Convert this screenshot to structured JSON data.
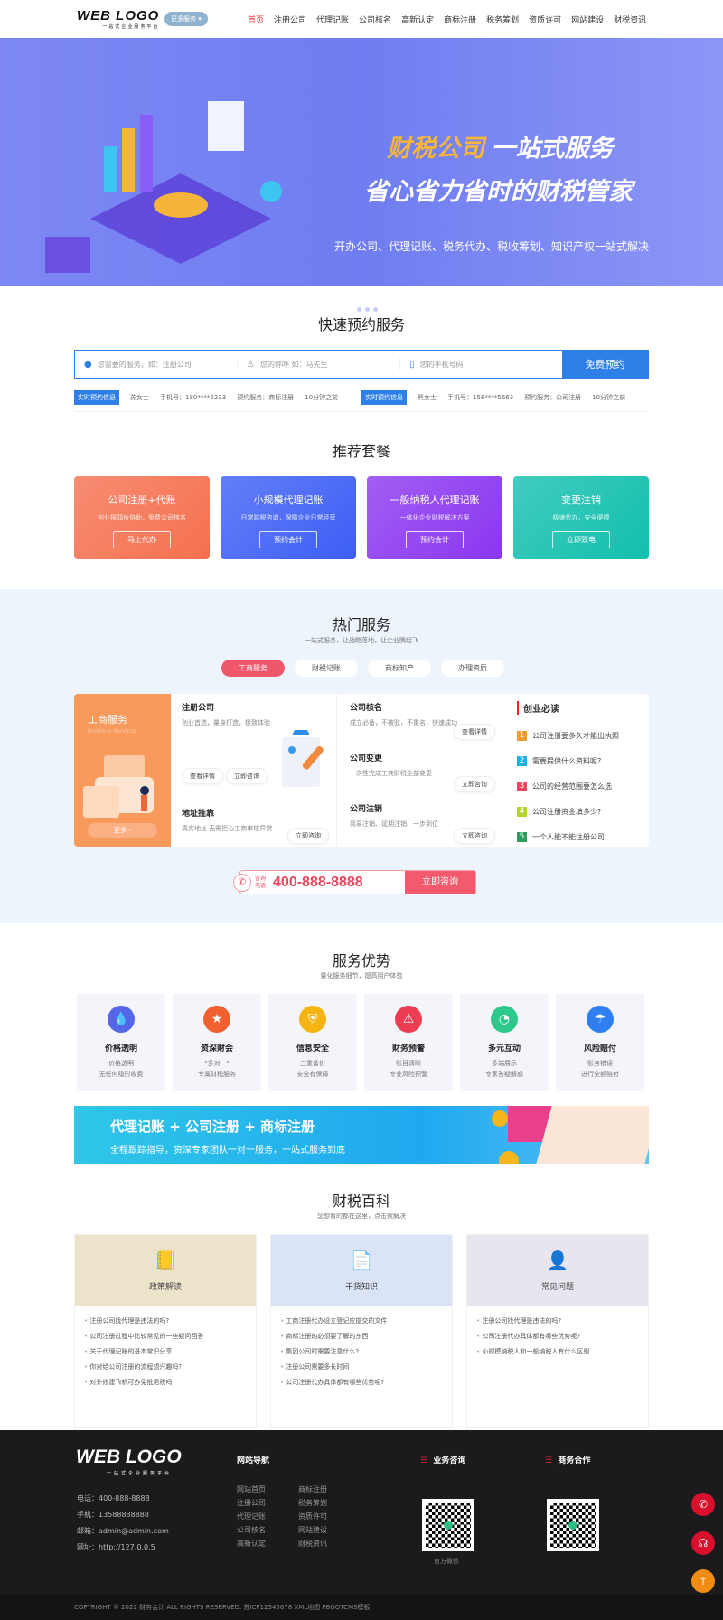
{
  "header": {
    "logo": "WEB LOGO",
    "logo_sub": "一站式企业服务平台",
    "more_button": "更多服务 ▾",
    "nav": [
      "首页",
      "注册公司",
      "代理记账",
      "公司核名",
      "高新认定",
      "商标注册",
      "税务筹划",
      "资质许可",
      "网站建设",
      "财税资讯"
    ],
    "active_nav": "首页"
  },
  "banner": {
    "title_accent": "财税公司",
    "title_rest": "一站式服务",
    "subtitle": "省心省力省时的财税管家",
    "desc": "开办公司、代理记账、税务代办、税收筹划、知识产权一站式解决",
    "slides": 4,
    "active_slide": 1
  },
  "booking": {
    "title": "快速预约服务",
    "service_placeholder": "您需要的服务，如：注册公司",
    "name_placeholder": "您的称呼 如：马先生",
    "phone_placeholder": "您的手机号码",
    "submit": "免费预约",
    "records": [
      {
        "tag": "实时预约信息",
        "name": "苏女士",
        "phone": "手机号：180****2233",
        "service": "预约服务：商标注册",
        "time": "10分钟之前"
      },
      {
        "tag": "实时预约信息",
        "name": "熊女士",
        "phone": "手机号：158****5663",
        "service": "预约服务：公司注册",
        "time": "10分钟之前"
      }
    ]
  },
  "packages": {
    "title": "推荐套餐",
    "items": [
      {
        "title": "公司注册+代账",
        "desc": "创业报四价协助，免费公司核名",
        "button": "马上代办",
        "color": "#f5704f"
      },
      {
        "title": "小规模代理记账",
        "desc": "日常财税咨询，保障企业日常经营",
        "button": "预约会计",
        "color": "#3d5ef5"
      },
      {
        "title": "一般纳税人代理记账",
        "desc": "一体化企业财税解决方案",
        "button": "预约会计",
        "color": "#8a36f0"
      },
      {
        "title": "变更注销",
        "desc": "极速代办，安全便捷",
        "button": "立即致电",
        "color": "#12bfae"
      }
    ]
  },
  "hot": {
    "title": "热门服务",
    "subtitle": "一站式服务，让战略落地，让企业腾起飞",
    "tabs": [
      "工商服务",
      "财税记账",
      "商标知产",
      "办理资质"
    ],
    "active_tab": "工商服务",
    "side": {
      "title": "工商服务",
      "subtitle": "Business Services",
      "more": "更多 ›"
    },
    "services": [
      {
        "title": "注册公司",
        "desc": "创业首选，量身打造，极致体验",
        "buttons": [
          "查看详情",
          "立即咨询"
        ]
      },
      {
        "title": "地址挂靠",
        "desc": "真实地址 无需担心工商审核异常",
        "buttons": [
          "立即咨询"
        ]
      },
      {
        "title": "公司核名",
        "desc": "成立必备，不被驳，不重名，快速成功",
        "buttons": [
          "查看详情"
        ]
      },
      {
        "title": "公司变更",
        "desc": "一次性完成工商财税全部变更",
        "buttons": [
          "立即咨询"
        ]
      },
      {
        "title": "公司注销",
        "desc": "简易注销、延期注销、一步到位",
        "buttons": [
          "立即咨询"
        ]
      }
    ],
    "reading": {
      "title": "创业必读",
      "items": [
        {
          "n": "1",
          "text": "公司注册要多久才能出执照",
          "color": "#f39a2d"
        },
        {
          "n": "2",
          "text": "需要提供什么资料呢?",
          "color": "#1eaee8"
        },
        {
          "n": "3",
          "text": "公司的经营范围要怎么选",
          "color": "#e8475e"
        },
        {
          "n": "4",
          "text": "公司注册资金填多少?",
          "color": "#b6d433"
        },
        {
          "n": "5",
          "text": "一个人能不能注册公司",
          "color": "#2e9c5f"
        }
      ]
    },
    "hotline": {
      "label1": "咨询",
      "label2": "电话",
      "number": "400-888-8888",
      "button": "立即咨询"
    }
  },
  "advantages": {
    "title": "服务优势",
    "subtitle": "量化服务细节，提高用户体验",
    "items": [
      {
        "title": "价格透明",
        "l1": "价格透明",
        "l2": "无任何隐形收费",
        "color": "#5566e8",
        "icon": "drop-icon"
      },
      {
        "title": "资深财会",
        "l1": "\"多对一\"",
        "l2": "专属财税服务",
        "color": "#f06030",
        "icon": "star-icon"
      },
      {
        "title": "信息安全",
        "l1": "三重备份",
        "l2": "安全有保障",
        "color": "#f5b412",
        "icon": "shield-icon"
      },
      {
        "title": "财务预警",
        "l1": "账目清晰",
        "l2": "专业风险预警",
        "color": "#ec3d52",
        "icon": "warning-icon"
      },
      {
        "title": "多元互动",
        "l1": "多端展示",
        "l2": "专家答疑解惑",
        "color": "#2cc98a",
        "icon": "chat-icon"
      },
      {
        "title": "风险赔付",
        "l1": "账务错误",
        "l2": "进行全额赔付",
        "color": "#2f7ff0",
        "icon": "umbrella-icon"
      }
    ]
  },
  "promo": {
    "title": "代理记账 + 公司注册 + 商标注册",
    "subtitle": "全程跟踪指导，资深专家团队一对一服务，一站式服务到底"
  },
  "wiki": {
    "title": "财税百科",
    "subtitle": "您想看的都在这里，点击就解决",
    "columns": [
      {
        "title": "政策解读",
        "bg": "#ebe4cb",
        "icon": "notebook-icon",
        "items": [
          "注册公司找代理是违法的吗?",
          "公司注册过程中比较常见的一些疑问回答",
          "关于代理记账的基本常识分享",
          "你对给公司注册的流程想兴趣吗?",
          "对外修建飞机可办免抵退税吗"
        ]
      },
      {
        "title": "干货知识",
        "bg": "#dae4f6",
        "icon": "document-icon",
        "items": [
          "工商注册代办设立登记应提交的文件",
          "商标注册的必须要了解的东西",
          "集团公司时需要注意什么?",
          "注册公司需要多长时间",
          "公司注册代办具体都有哪些优势呢?"
        ]
      },
      {
        "title": "常见问题",
        "bg": "#e9e5ef",
        "icon": "user-check-icon",
        "items": [
          "注册公司找代理是违法的吗?",
          "公司注册代办具体都有哪些优势呢?",
          "小规模纳税人和一般纳税人有什么区别"
        ]
      }
    ]
  },
  "footer": {
    "logo": "WEB LOGO",
    "logo_sub": "一站式企业服务平台",
    "contacts": [
      "电话：400-888-8888",
      "手机：13588888888",
      "邮箱：admin@admin.com",
      "网址：http://127.0.0.5"
    ],
    "nav_title": "网站导航",
    "nav": [
      "网站首页",
      "注册公司",
      "代理记账",
      "公司核名",
      "高新认定",
      "商标注册",
      "税务筹划",
      "资质许可",
      "网站建设",
      "财税资讯"
    ],
    "consult_title": "业务咨询",
    "consult_caption": "官方微信",
    "coop_title": "商务合作",
    "copyright": "COPYRIGHT © 2022 财务会计 ALL RIGHTS RESERVED.   苏ICP12345678    XML地图    PBOOTCMS模板"
  }
}
